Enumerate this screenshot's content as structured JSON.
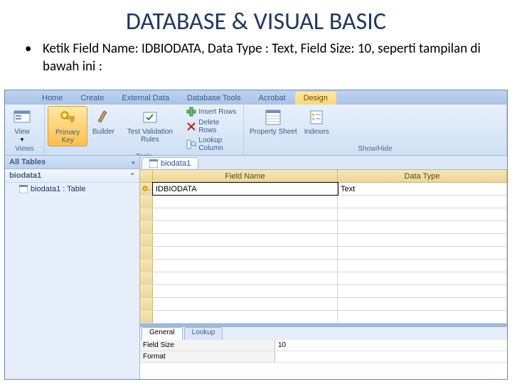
{
  "slide": {
    "title": "DATABASE & VISUAL BASIC",
    "bullet": "Ketik Field Name: IDBIODATA, Data Type : Text, Field Size: 10, seperti tampilan di bawah ini :"
  },
  "ribbon": {
    "tabs": [
      "Home",
      "Create",
      "External Data",
      "Database Tools",
      "Acrobat",
      "Design"
    ],
    "groups": [
      {
        "label": "Views",
        "buttons": [
          "View"
        ]
      },
      {
        "label": "Tools",
        "buttons": [
          "Primary\nKey",
          "Builder",
          "Test Validation\nRules"
        ],
        "small": [
          "Insert Rows",
          "Delete Rows",
          "Lookup Column"
        ]
      },
      {
        "label": "Show/Hide",
        "buttons": [
          "Property\nSheet",
          "Indexes"
        ]
      }
    ]
  },
  "nav": {
    "header": "All Tables",
    "group": "biodata1",
    "item": "biodata1 : Table"
  },
  "doc": {
    "tab": "biodata1"
  },
  "grid": {
    "cols": [
      "Field Name",
      "Data Type"
    ],
    "rows": [
      {
        "field": "IDBIODATA",
        "type": "Text"
      }
    ]
  },
  "props": {
    "tabs": [
      "General",
      "Lookup"
    ],
    "rows": [
      {
        "name": "Field Size",
        "value": "10"
      },
      {
        "name": "Format",
        "value": ""
      }
    ]
  }
}
